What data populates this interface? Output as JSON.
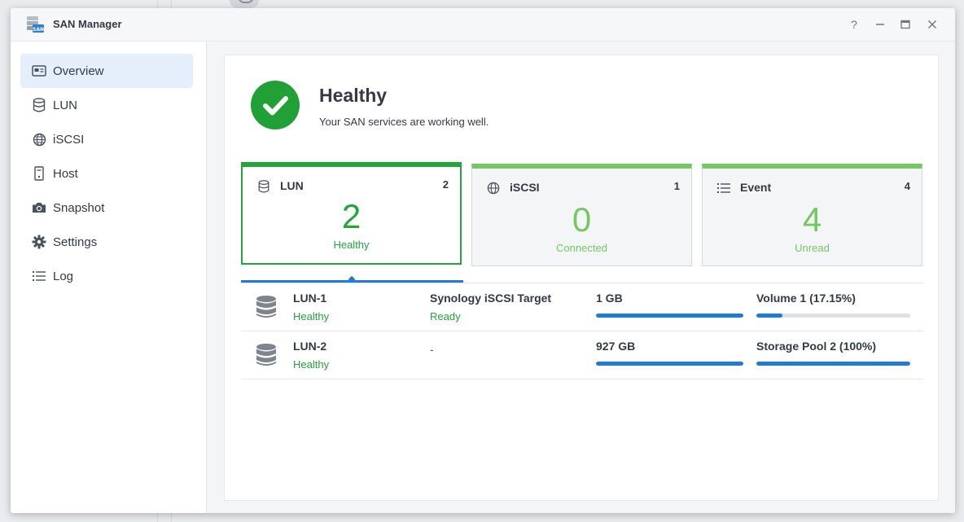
{
  "window": {
    "title": "SAN Manager",
    "help": "?",
    "minimize": "—",
    "maximize": "▭",
    "close": "✕"
  },
  "sidebar": {
    "items": [
      {
        "label": "Overview",
        "icon": "overview-icon",
        "active": true
      },
      {
        "label": "LUN",
        "icon": "database-icon"
      },
      {
        "label": "iSCSI",
        "icon": "globe-icon"
      },
      {
        "label": "Host",
        "icon": "host-icon"
      },
      {
        "label": "Snapshot",
        "icon": "camera-icon"
      },
      {
        "label": "Settings",
        "icon": "gear-icon"
      },
      {
        "label": "Log",
        "icon": "list-icon"
      }
    ]
  },
  "status": {
    "title": "Healthy",
    "subtitle": "Your SAN services are working well.",
    "color": "#21a035"
  },
  "cards": [
    {
      "title": "LUN",
      "count": "2",
      "value": "2",
      "status": "Healthy",
      "icon": "database-icon"
    },
    {
      "title": "iSCSI",
      "count": "1",
      "value": "0",
      "status": "Connected",
      "icon": "globe-icon"
    },
    {
      "title": "Event",
      "count": "4",
      "value": "4",
      "status": "Unread",
      "icon": "list-icon"
    }
  ],
  "luns": [
    {
      "name": "LUN-1",
      "health": "Healthy",
      "target": "Synology iSCSI Target",
      "target_status": "Ready",
      "size": "1 GB",
      "size_fill": 1.0,
      "location": "Volume 1 (17.15%)",
      "location_fill": 0.1715
    },
    {
      "name": "LUN-2",
      "health": "Healthy",
      "target": "-",
      "target_status": "",
      "size": "927 GB",
      "size_fill": 1.0,
      "location": "Storage Pool 2 (100%)",
      "location_fill": 1.0
    }
  ],
  "colors": {
    "accent": "#1f7bd8",
    "healthy": "#22a53a",
    "card_green": "#74c860"
  }
}
